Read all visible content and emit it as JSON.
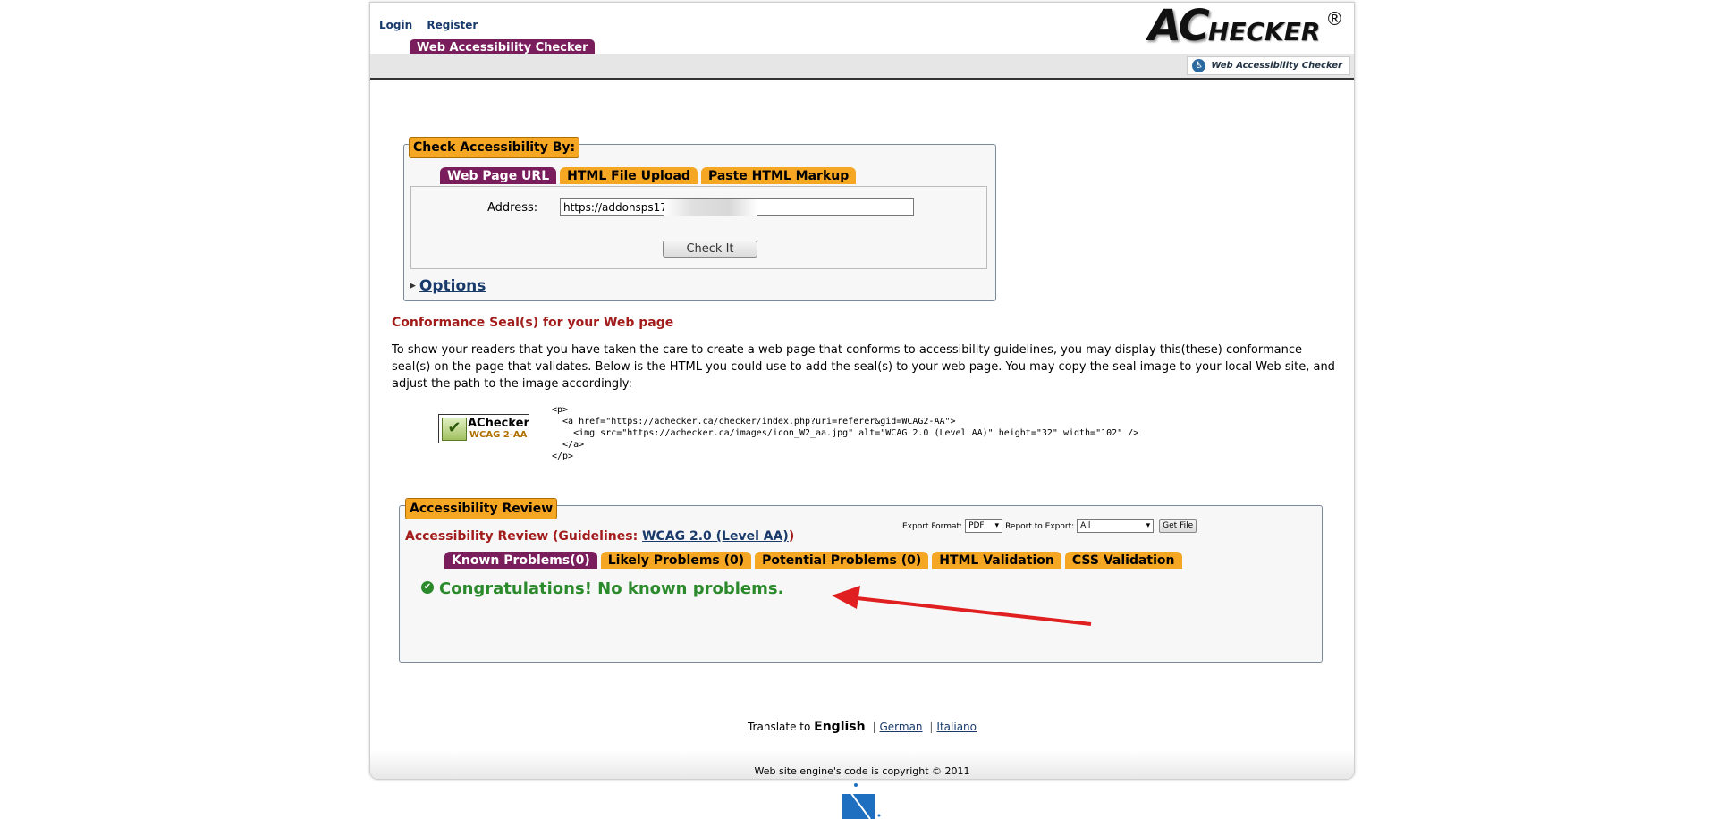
{
  "auth": {
    "login": "Login",
    "register": "Register"
  },
  "logo": {
    "big": "AC",
    "small": "HECKER",
    "reg": "®"
  },
  "site_tab": "Web Accessibility Checker",
  "header_badge": "Web Accessibility Checker",
  "check": {
    "legend": "Check Accessibility By:",
    "tabs": [
      "Web Page URL",
      "HTML File Upload",
      "Paste HTML Markup"
    ],
    "address_label": "Address:",
    "address_value": "https://addonsps1771.p",
    "check_button": "Check It",
    "options": "Options"
  },
  "seal": {
    "heading": "Conformance Seal(s) for your Web page",
    "text": "To show your readers that you have taken the care to create a web page that conforms to accessibility guidelines, you may display this(these) conformance seal(s) on the page that validates. Below is the HTML you could use to add the seal(s) to your web page. You may copy the seal image to your local Web site, and adjust the path to the image accordingly:",
    "badge_title": "AChecker",
    "badge_sub": "WCAG 2-AA",
    "code": "<p>\n  <a href=\"https://achecker.ca/checker/index.php?uri=referer&gid=WCAG2-AA\">\n    <img src=\"https://achecker.ca/images/icon_W2_aa.jpg\" alt=\"WCAG 2.0 (Level AA)\" height=\"32\" width=\"102\" />\n  </a>\n</p>"
  },
  "review": {
    "legend": "Accessibility Review",
    "heading_prefix": "Accessibility Review (Guidelines: ",
    "heading_link": "WCAG 2.0 (Level AA)",
    "heading_suffix": ")",
    "export_label": "Export Format:",
    "export_value": "PDF",
    "report_label": "Report to Export:",
    "report_value": "All",
    "get_file": "Get File",
    "tabs": [
      "Known Problems(0)",
      "Likely Problems (0)",
      "Potential Problems (0)",
      "HTML Validation",
      "CSS Validation"
    ],
    "congrats": "Congratulations! No known problems."
  },
  "translate": {
    "label": "Translate to ",
    "current": "English",
    "links": [
      "German",
      "Italiano"
    ]
  },
  "footer": "Web site engine's code is copyright © 2011"
}
